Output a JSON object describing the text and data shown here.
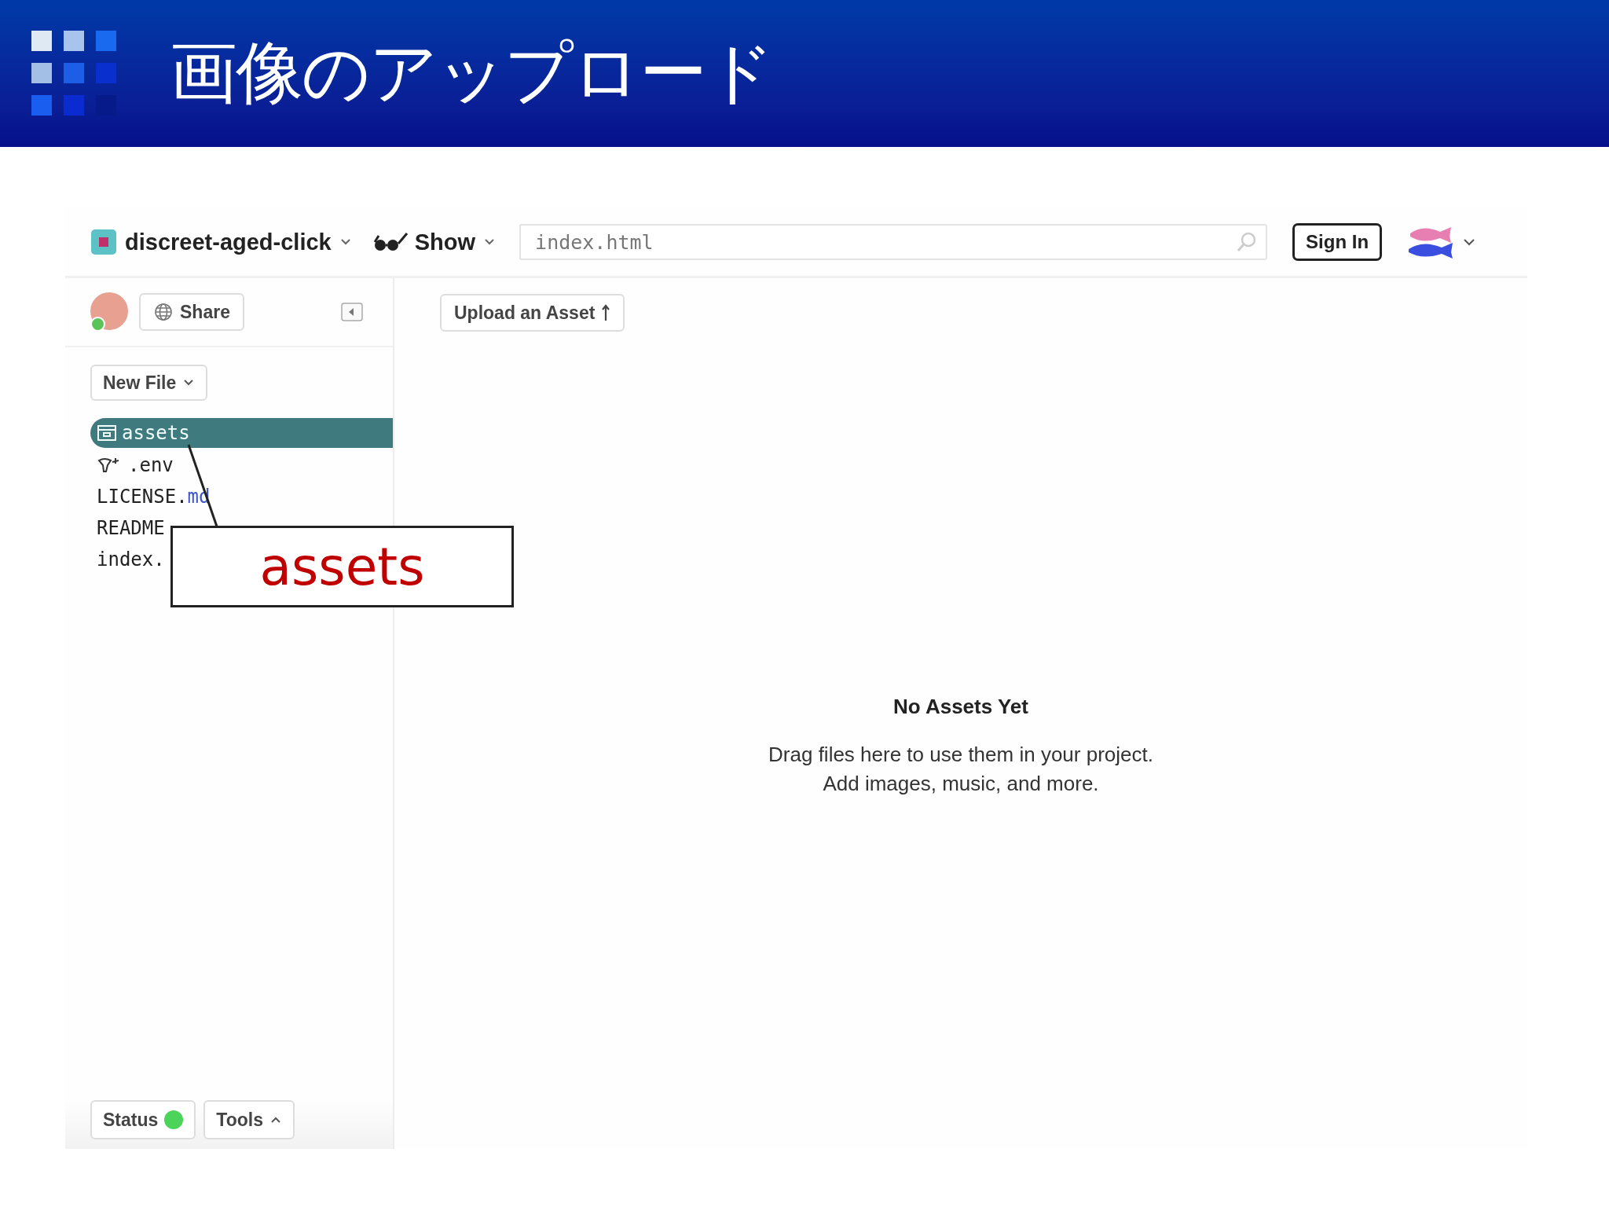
{
  "slide": {
    "title": "画像のアップロード"
  },
  "topbar": {
    "project": "discreet-aged-click",
    "show": "Show",
    "search": {
      "value": "index.html"
    },
    "sign_in": "Sign In"
  },
  "sidebar": {
    "share": "Share",
    "new_file": "New File",
    "files": [
      {
        "kind": "folder",
        "name": "assets",
        "selected": true
      },
      {
        "kind": "env",
        "name": ".env",
        "selected": false
      },
      {
        "kind": "file",
        "name": "LICENSE.",
        "ext": "md",
        "selected": false
      },
      {
        "kind": "file",
        "name": "README",
        "selected": false
      },
      {
        "kind": "file",
        "name": "index.",
        "selected": false
      }
    ],
    "status": "Status",
    "tools": "Tools"
  },
  "main": {
    "upload": "Upload an Asset",
    "empty_title": "No Assets Yet",
    "empty_lines": [
      "Drag files here to use them in your project.",
      "Add images, music, and more."
    ]
  },
  "callout": {
    "text": "assets"
  }
}
